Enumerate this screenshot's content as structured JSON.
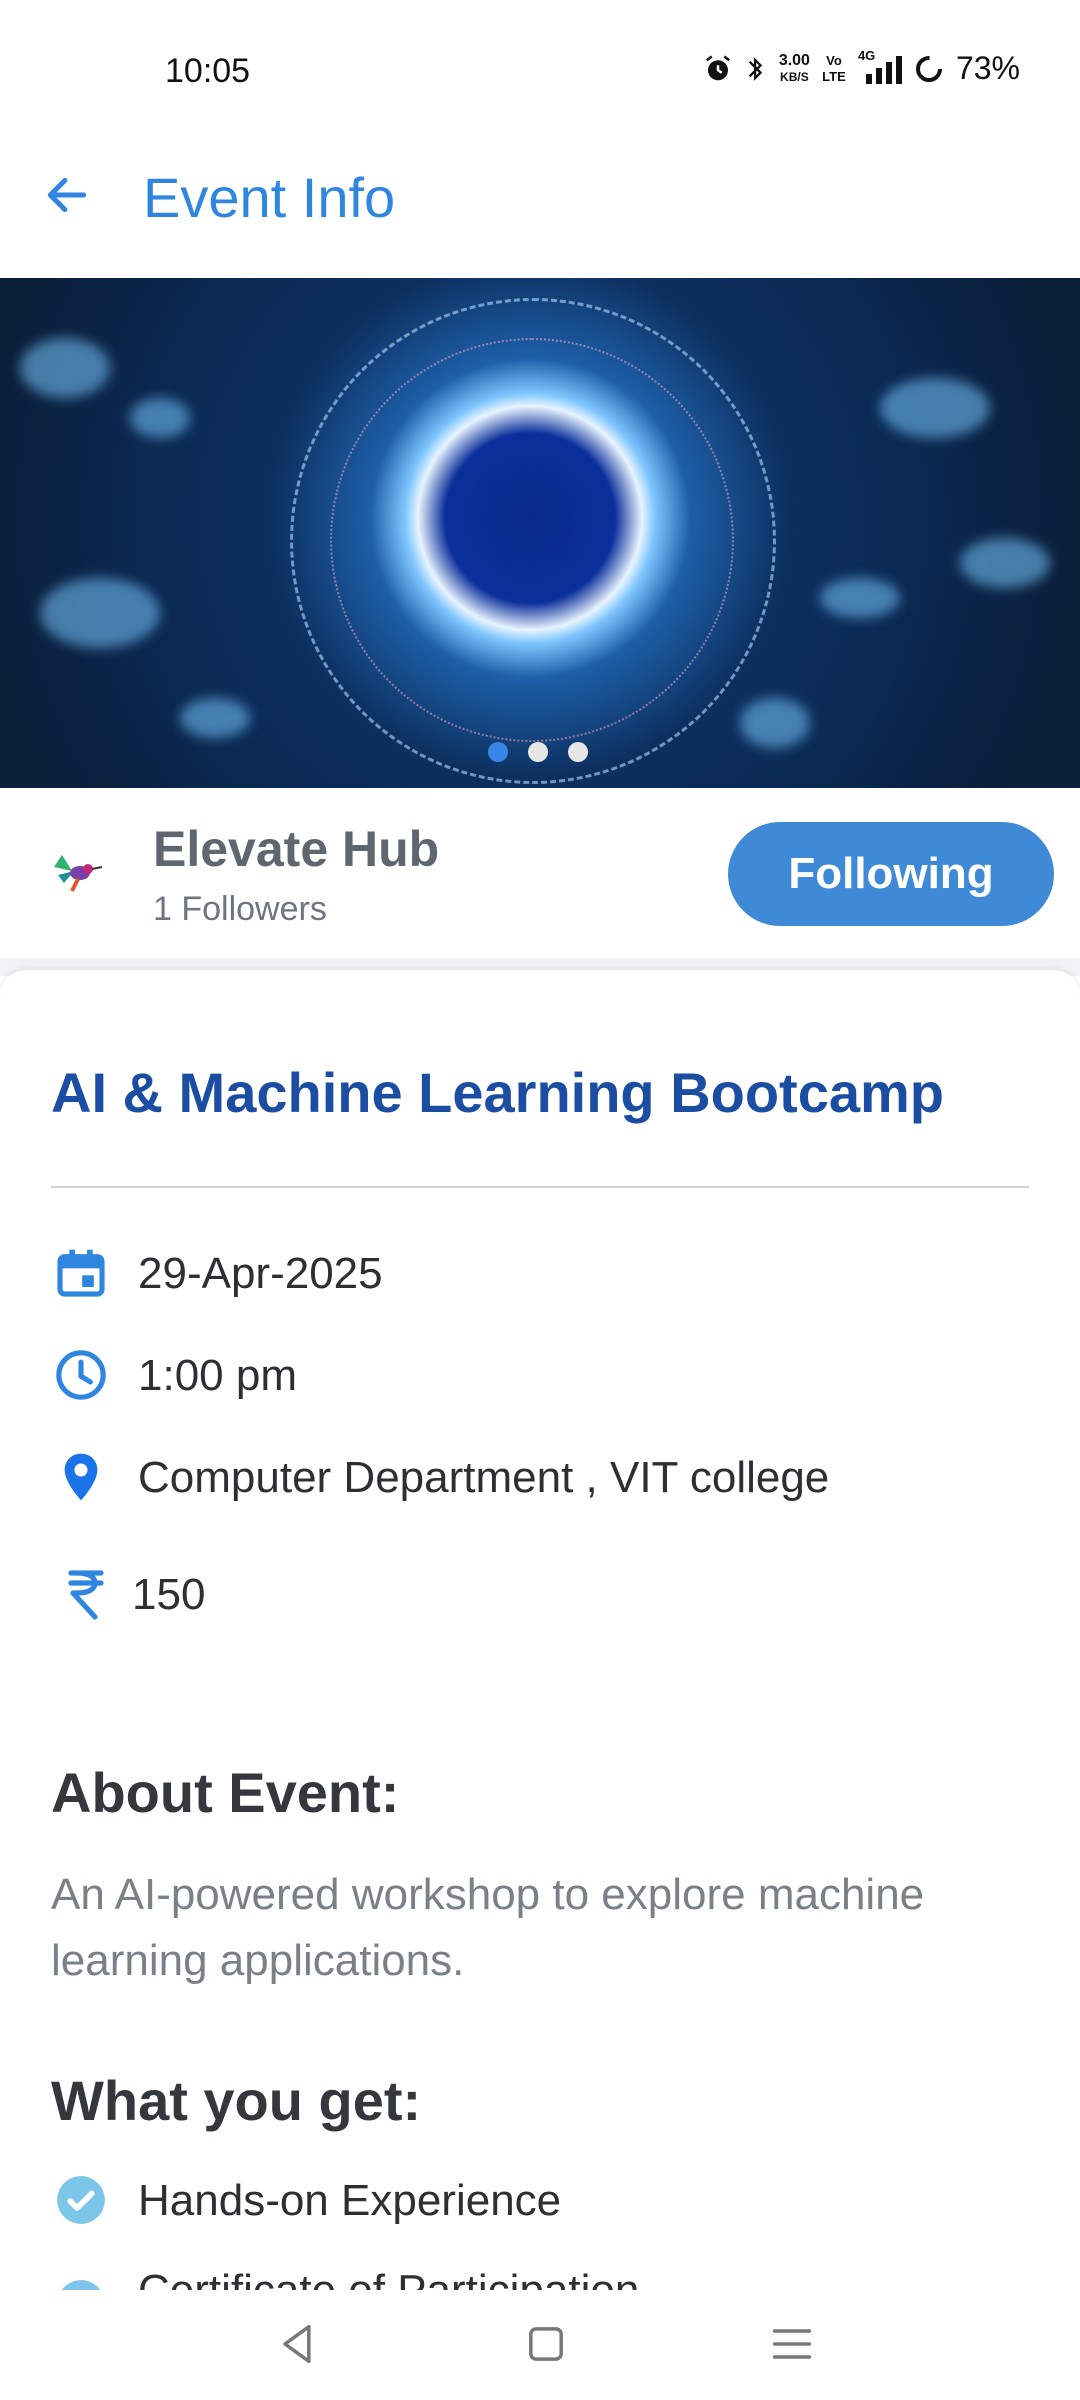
{
  "status": {
    "time": "10:05",
    "speed": "3.00",
    "speed_unit": "KB/S",
    "volte": "Vo LTE",
    "network": "4G",
    "battery": "73%"
  },
  "app_bar": {
    "title": "Event Info"
  },
  "carousel": {
    "pages": 3,
    "active_index": 0
  },
  "organizer": {
    "name": "Elevate Hub",
    "followers": "1 Followers",
    "follow_label": "Following"
  },
  "event": {
    "title": "AI & Machine Learning Bootcamp",
    "date": "29-Apr-2025",
    "time": "1:00 pm",
    "location": "Computer Department , VIT college",
    "currency_icon": "rupee-icon",
    "price": "150"
  },
  "about": {
    "heading": "About Event:",
    "body": "An AI-powered workshop to explore machine learning applications."
  },
  "benefits": {
    "heading": "What you get:",
    "items": [
      "Hands-on Experience",
      "Certificate of Participation"
    ]
  },
  "colors": {
    "accent": "#2f86e0",
    "title_blue": "#1b4ea3",
    "follow_button": "#3f8ad6",
    "carousel_active": "#3a86e8"
  }
}
